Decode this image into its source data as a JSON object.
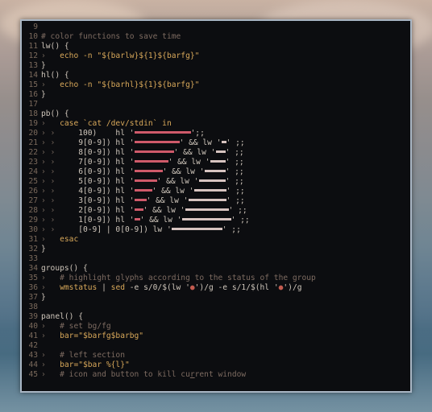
{
  "terminal": {
    "lines": [
      {
        "n": "9",
        "parts": []
      },
      {
        "n": "10",
        "parts": [
          {
            "c": "t-cm",
            "t": "# color functions to save time"
          }
        ]
      },
      {
        "n": "11",
        "parts": [
          {
            "c": "t-def",
            "t": "lw() {"
          }
        ]
      },
      {
        "n": "12",
        "parts": [
          {
            "c": "t-dim",
            "t": "› "
          },
          {
            "c": "t-kw",
            "t": "  echo -n \"${barlw}${1}${barfg}\""
          }
        ]
      },
      {
        "n": "13",
        "parts": [
          {
            "c": "t-def",
            "t": "}"
          }
        ]
      },
      {
        "n": "14",
        "parts": [
          {
            "c": "t-def",
            "t": "hl() {"
          }
        ]
      },
      {
        "n": "15",
        "parts": [
          {
            "c": "t-dim",
            "t": "› "
          },
          {
            "c": "t-kw",
            "t": "  echo -n \"${barhl}${1}${barfg}\""
          }
        ]
      },
      {
        "n": "16",
        "parts": [
          {
            "c": "t-def",
            "t": "}"
          }
        ]
      },
      {
        "n": "17",
        "parts": []
      },
      {
        "n": "18",
        "parts": [
          {
            "c": "t-def",
            "t": "pb() {"
          }
        ]
      },
      {
        "n": "19",
        "parts": [
          {
            "c": "t-dim",
            "t": "› "
          },
          {
            "c": "t-kw",
            "t": "  case `cat /dev/stdin` in"
          }
        ]
      },
      {
        "n": "20",
        "parts": [
          {
            "c": "t-dim",
            "t": "› ›  "
          },
          {
            "c": "t-def",
            "t": "   100)    hl '"
          },
          {
            "bar": 70
          },
          {
            "c": "t-def",
            "t": "';;"
          }
        ]
      },
      {
        "n": "21",
        "parts": [
          {
            "c": "t-dim",
            "t": "› ›  "
          },
          {
            "c": "t-def",
            "t": "   9[0-9]) hl '"
          },
          {
            "bar": 56
          },
          {
            "c": "t-def",
            "t": "' && lw '"
          },
          {
            "lbar": 6
          },
          {
            "c": "t-def",
            "t": "' ;;"
          }
        ]
      },
      {
        "n": "22",
        "parts": [
          {
            "c": "t-dim",
            "t": "› ›  "
          },
          {
            "c": "t-def",
            "t": "   8[0-9]) hl '"
          },
          {
            "bar": 49
          },
          {
            "c": "t-def",
            "t": "' && lw '"
          },
          {
            "lbar": 12
          },
          {
            "c": "t-def",
            "t": "' ;;"
          }
        ]
      },
      {
        "n": "23",
        "parts": [
          {
            "c": "t-dim",
            "t": "› ›  "
          },
          {
            "c": "t-def",
            "t": "   7[0-9]) hl '"
          },
          {
            "bar": 42
          },
          {
            "c": "t-def",
            "t": "' && lw '"
          },
          {
            "lbar": 19
          },
          {
            "c": "t-def",
            "t": "' ;;"
          }
        ]
      },
      {
        "n": "24",
        "parts": [
          {
            "c": "t-dim",
            "t": "› ›  "
          },
          {
            "c": "t-def",
            "t": "   6[0-9]) hl '"
          },
          {
            "bar": 35
          },
          {
            "c": "t-def",
            "t": "' && lw '"
          },
          {
            "lbar": 26
          },
          {
            "c": "t-def",
            "t": "' ;;"
          }
        ]
      },
      {
        "n": "25",
        "parts": [
          {
            "c": "t-dim",
            "t": "› ›  "
          },
          {
            "c": "t-def",
            "t": "   5[0-9]) hl '"
          },
          {
            "bar": 28
          },
          {
            "c": "t-def",
            "t": "' && lw '"
          },
          {
            "lbar": 33
          },
          {
            "c": "t-def",
            "t": "' ;;"
          }
        ]
      },
      {
        "n": "26",
        "parts": [
          {
            "c": "t-dim",
            "t": "› ›  "
          },
          {
            "c": "t-def",
            "t": "   4[0-9]) hl '"
          },
          {
            "bar": 22
          },
          {
            "c": "t-def",
            "t": "' && lw '"
          },
          {
            "lbar": 40
          },
          {
            "c": "t-def",
            "t": "' ;;"
          }
        ]
      },
      {
        "n": "27",
        "parts": [
          {
            "c": "t-dim",
            "t": "› ›  "
          },
          {
            "c": "t-def",
            "t": "   3[0-9]) hl '"
          },
          {
            "bar": 15
          },
          {
            "c": "t-def",
            "t": "' && lw '"
          },
          {
            "lbar": 47
          },
          {
            "c": "t-def",
            "t": "' ;;"
          }
        ]
      },
      {
        "n": "28",
        "parts": [
          {
            "c": "t-dim",
            "t": "› ›  "
          },
          {
            "c": "t-def",
            "t": "   2[0-9]) hl '"
          },
          {
            "bar": 11
          },
          {
            "c": "t-def",
            "t": "' && lw '"
          },
          {
            "lbar": 54
          },
          {
            "c": "t-def",
            "t": "' ;;"
          }
        ]
      },
      {
        "n": "29",
        "parts": [
          {
            "c": "t-dim",
            "t": "› ›  "
          },
          {
            "c": "t-def",
            "t": "   1[0-9]) hl '"
          },
          {
            "bar": 7
          },
          {
            "c": "t-def",
            "t": "' && lw '"
          },
          {
            "lbar": 61
          },
          {
            "c": "t-def",
            "t": "' ;;"
          }
        ]
      },
      {
        "n": "30",
        "parts": [
          {
            "c": "t-dim",
            "t": "› ›  "
          },
          {
            "c": "t-def",
            "t": "   [0-9] | 0[0-9]) lw '"
          },
          {
            "lbar": 63
          },
          {
            "c": "t-def",
            "t": "' ;;"
          }
        ]
      },
      {
        "n": "31",
        "parts": [
          {
            "c": "t-dim",
            "t": "› "
          },
          {
            "c": "t-kw",
            "t": "  esac"
          }
        ]
      },
      {
        "n": "32",
        "parts": [
          {
            "c": "t-def",
            "t": "}"
          }
        ]
      },
      {
        "n": "33",
        "parts": []
      },
      {
        "n": "34",
        "parts": [
          {
            "c": "t-def",
            "t": "groups() {"
          }
        ]
      },
      {
        "n": "35",
        "parts": [
          {
            "c": "t-dim",
            "t": "› "
          },
          {
            "c": "t-cm",
            "t": "  # highlight glyphs according to the status of the group"
          }
        ]
      },
      {
        "n": "36",
        "parts": [
          {
            "c": "t-dim",
            "t": "› "
          },
          {
            "c": "t-kw",
            "t": "  wmstatus "
          },
          {
            "c": "t-def",
            "t": "| "
          },
          {
            "c": "t-kw",
            "t": "sed "
          },
          {
            "c": "t-def",
            "t": "-e s/0/$(lw '"
          },
          {
            "c": "t-red",
            "t": "●"
          },
          {
            "c": "t-def",
            "t": "')/g -e s/1/$(hl '"
          },
          {
            "c": "t-red",
            "t": "●"
          },
          {
            "c": "t-def",
            "t": "')/g"
          }
        ]
      },
      {
        "n": "37",
        "parts": [
          {
            "c": "t-def",
            "t": "}"
          }
        ]
      },
      {
        "n": "38",
        "parts": []
      },
      {
        "n": "39",
        "parts": [
          {
            "c": "t-def",
            "t": "panel() {"
          }
        ]
      },
      {
        "n": "40",
        "parts": [
          {
            "c": "t-dim",
            "t": "› "
          },
          {
            "c": "t-cm",
            "t": "  # set bg/fg"
          }
        ]
      },
      {
        "n": "41",
        "parts": [
          {
            "c": "t-dim",
            "t": "› "
          },
          {
            "c": "t-kw",
            "t": "  bar=\"$barfg$barbg\""
          }
        ]
      },
      {
        "n": "42",
        "parts": []
      },
      {
        "n": "43",
        "parts": [
          {
            "c": "t-dim",
            "t": "› "
          },
          {
            "c": "t-cm",
            "t": "  # left section"
          }
        ]
      },
      {
        "n": "44",
        "parts": [
          {
            "c": "t-dim",
            "t": "› "
          },
          {
            "c": "t-kw",
            "t": "  bar=\"$bar %{l}\""
          }
        ]
      },
      {
        "n": "45",
        "parts": [
          {
            "c": "t-dim",
            "t": "› "
          },
          {
            "c": "t-cm",
            "t": "  # icon and button to kill cu"
          },
          {
            "c": "t-cm cursor",
            "t": "r"
          },
          {
            "c": "t-cm",
            "t": "rent window"
          }
        ]
      }
    ]
  }
}
